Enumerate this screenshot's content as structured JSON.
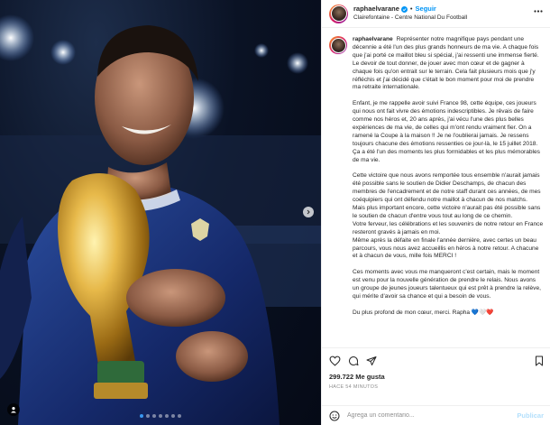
{
  "photo": {
    "alt_subject": "player-with-trophy",
    "carousel_dots": 7,
    "active_dot": 0
  },
  "header": {
    "username": "raphaelvarane",
    "separator": "•",
    "follow_label": "Seguir",
    "location": "Clairefontaine - Centre National Du Football"
  },
  "caption": {
    "username": "raphaelvarane",
    "paragraphs": [
      "Représenter notre magnifique pays pendant une décennie a été l'un des plus grands honneurs de ma vie. A chaque fois que j'ai porté ce maillot bleu si spécial, j'ai ressenti une immense fierté. Le devoir de tout donner, de jouer avec mon cœur et de gagner à chaque fois qu'on entrait sur le terrain. Cela fait plusieurs mois que j'y réfléchis et j'ai décidé que c'était le bon moment pour moi de prendre ma retraite internationale.",
      "Enfant, je me rappelle avoir suivi France 98, cette équipe, ces joueurs qui nous ont fait vivre des émotions indescriptibles. Je rêvais de faire comme nos héros et, 20 ans après, j'ai vécu l'une des plus belles expériences de ma vie, de celles qui m'ont rendu vraiment fier. On a ramené la Coupe à la maison !! Je ne l'oublierai jamais. Je ressens toujours chacune des émotions ressenties ce jour-là, le 15 juillet 2018. Ça a été l'un des moments les plus formidables et les plus mémorables de ma vie.",
      "Cette victoire que nous avons remportée tous ensemble n'aurait jamais été possible sans le soutien de Didier Deschamps, de chacun des membres de l'encadrement et de notre staff durant ces années, de mes coéquipiers qui ont défendu notre maillot à chacun de nos matchs.\nMais plus important encore, cette victoire n'aurait pas été possible sans le soutien de chacun d'entre vous tout au long de ce chemin.\nVotre ferveur, les célébrations et les souvenirs de notre retour en France resteront gravés à jamais en moi.\nMême après la défaite en finale l'année dernière, avec certes un beau parcours, vous nous avez accueillis en héros à notre retour. A chacune et à chacun de vous, mille fois MERCI !",
      "Ces moments avec vous me manqueront c'est certain, mais le moment est venu pour la nouvelle génération de prendre le relais. Nous avons un groupe de jeunes joueurs talentueux qui est prêt à prendre la relève, qui mérite d'avoir sa chance et qui a besoin de vous.",
      "Du plus profond de mon cœur, merci. Rapha 💙🤍❤️"
    ]
  },
  "actions": {
    "likes_count": "299.722",
    "likes_label": "Me gusta",
    "timestamp": "HACE 54 MINUTOS"
  },
  "comment": {
    "placeholder": "Agrega un comentario...",
    "publish_label": "Publicar"
  },
  "colors": {
    "link_blue": "#0095f6",
    "publish_disabled": "#b2dffc",
    "muted": "#8e8e8e"
  }
}
